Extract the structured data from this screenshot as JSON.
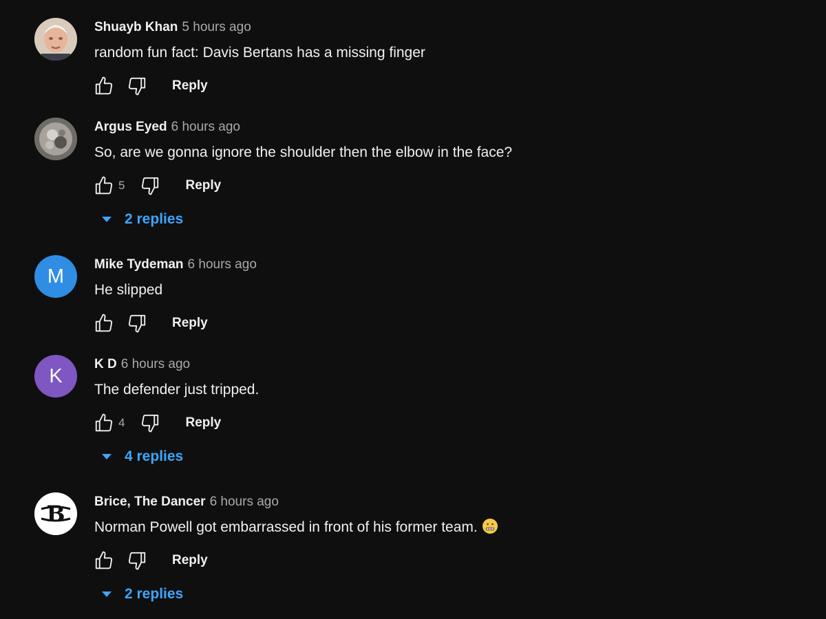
{
  "comments": [
    {
      "author": "Shuayb Khan",
      "time": "5 hours ago",
      "text": "random fun fact: Davis Bertans has a missing finger",
      "likes": "",
      "reply_label": "Reply",
      "avatar_icon": "photo-avatar-icon"
    },
    {
      "author": "Argus Eyed",
      "time": "6 hours ago",
      "text": "So, are we gonna ignore the shoulder then the elbow in the face?",
      "likes": "5",
      "reply_label": "Reply",
      "replies_label": "2 replies",
      "avatar_icon": "photo-avatar-icon"
    },
    {
      "author": "Mike Tydeman",
      "time": "6 hours ago",
      "text": "He slipped",
      "likes": "",
      "reply_label": "Reply",
      "avatar_letter": "M",
      "avatar_color": "#2f8de4"
    },
    {
      "author": "K D",
      "time": "6 hours ago",
      "text": "The defender just tripped.",
      "likes": "4",
      "reply_label": "Reply",
      "replies_label": "4 replies",
      "avatar_letter": "K",
      "avatar_color": "#7e57c2"
    },
    {
      "author": "Brice, The Dancer",
      "time": "6 hours ago",
      "text": "Norman Powell got embarrassed in front of his former team.",
      "emoji": "grimacing-face-icon",
      "likes": "",
      "reply_label": "Reply",
      "replies_label": "2 replies",
      "avatar_letter": "B",
      "avatar_color": "#ffffff"
    }
  ],
  "colors": {
    "background": "#0f0f0f",
    "text": "#f1f1f1",
    "muted": "#aaaaaa",
    "link": "#3ea6ff"
  }
}
